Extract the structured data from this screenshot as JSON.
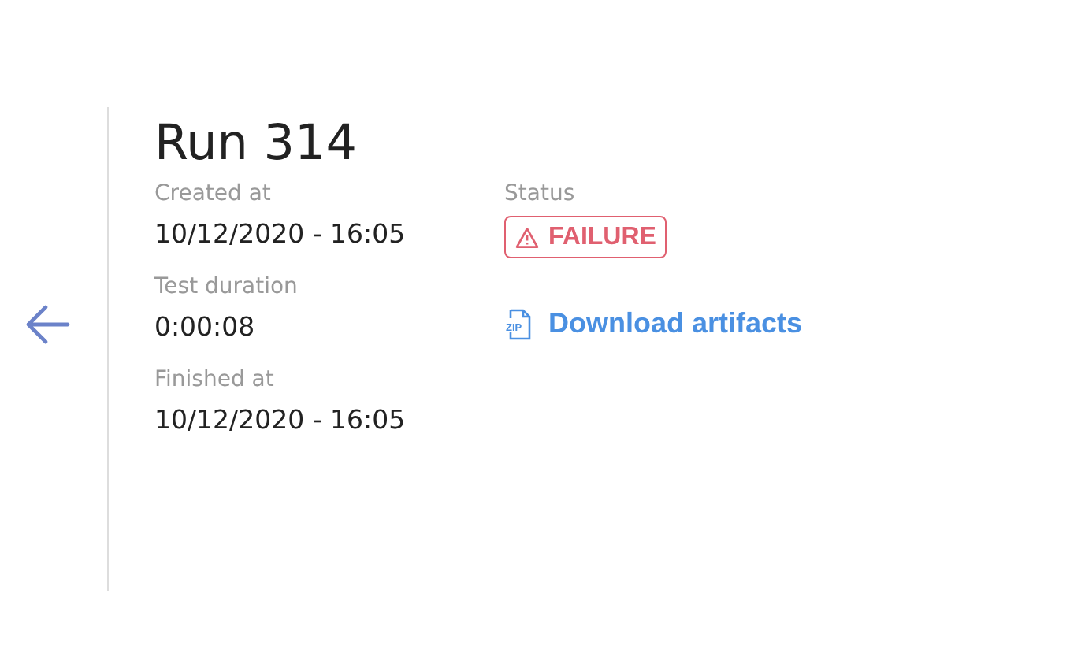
{
  "title": "Run 314",
  "fields": [
    {
      "label": "Created at",
      "value": "10/12/2020 - 16:05"
    },
    {
      "label": "Test duration",
      "value": "0:00:08"
    },
    {
      "label": "Finished at",
      "value": "10/12/2020 - 16:05"
    }
  ],
  "status": {
    "label": "Status",
    "value": "FAILURE",
    "kind": "failure"
  },
  "download": {
    "label": "Download artifacts",
    "icon_label": "ZIP"
  }
}
